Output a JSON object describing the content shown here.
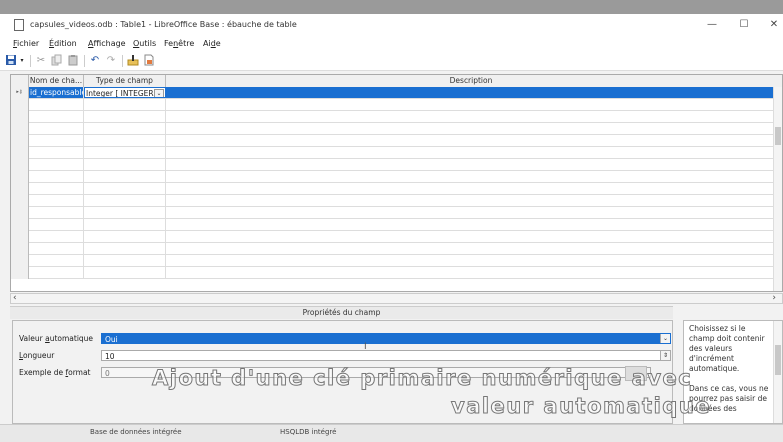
{
  "window": {
    "title": "capsules_videos.odb : Table1 - LibreOffice Base : ébauche de table",
    "minimize": "—",
    "maximize": "☐",
    "close": "✕"
  },
  "menu": [
    {
      "pre": "",
      "ul": "F",
      "post": "ichier"
    },
    {
      "pre": "",
      "ul": "É",
      "post": "dition"
    },
    {
      "pre": "",
      "ul": "A",
      "post": "ffichage"
    },
    {
      "pre": "",
      "ul": "O",
      "post": "utils"
    },
    {
      "pre": "Fe",
      "ul": "n",
      "post": "être"
    },
    {
      "pre": "Ai",
      "ul": "d",
      "post": "e"
    }
  ],
  "toolbar": {
    "save_icon": "save-icon",
    "cut_icon": "cut-icon",
    "copy_icon": "copy-icon",
    "paste_icon": "paste-icon",
    "undo_icon": "undo-icon",
    "redo_icon": "redo-icon",
    "primary_key_icon": "primary-key-icon",
    "index_icon": "index-design-icon"
  },
  "grid": {
    "headers": [
      "Nom de cha...",
      "Type de champ",
      "Description"
    ],
    "rows": [
      {
        "marker": "▸⚷",
        "name": "id_responsable",
        "type": "Integer [ INTEGER ]",
        "description": ""
      }
    ],
    "empty_rows": 15
  },
  "properties": {
    "title": "Propriétés du champ",
    "auto_value": {
      "label_pre": "Valeur ",
      "label_ul": "a",
      "label_post": "utomatique",
      "value": "Oui"
    },
    "length": {
      "label_pre": "",
      "label_ul": "L",
      "label_post": "ongueur",
      "value": "10"
    },
    "format_example": {
      "label_pre": "Exemple de ",
      "label_ul": "f",
      "label_post": "ormat",
      "value": "0"
    }
  },
  "help_text": "Choisissez si le champ doit contenir des valeurs d'incrément automatique.\n\nDans ce cas, vous ne pourrez pas saisir de données des",
  "status": {
    "left": "Base de données intégrée",
    "right": "HSQLDB intégré"
  },
  "caption": {
    "line1": "Ajout d'une clé primaire numérique avec",
    "line2": "valeur automatique"
  }
}
